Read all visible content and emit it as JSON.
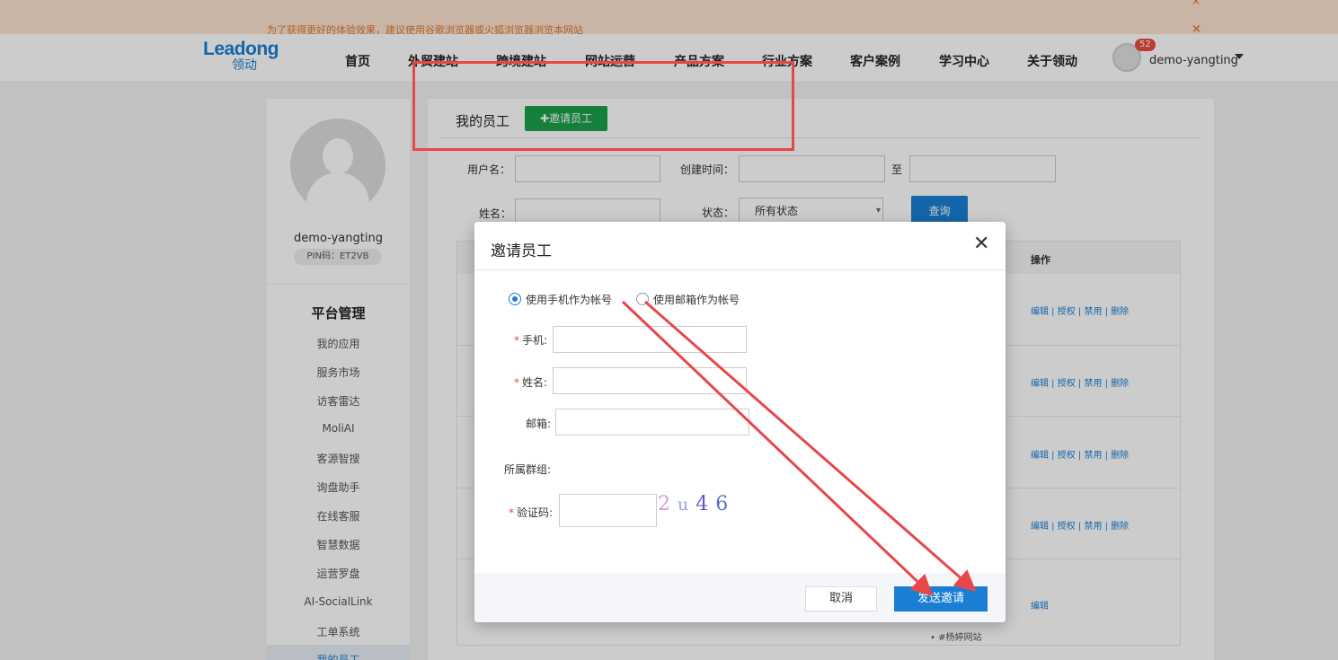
{
  "notices": {
    "line1": "",
    "line1_link": "",
    "line2": "为了获得更好的体验效果，建议使用谷歌浏览器或火狐浏览器浏览本网站",
    "close": "×"
  },
  "nav": {
    "logo_en": "Leadong",
    "logo_cn": "领动",
    "items": [
      "首页",
      "外贸建站",
      "跨境建站",
      "网站运营",
      "产品方案",
      "行业方案",
      "客户案例",
      "学习中心",
      "关于领动"
    ],
    "badge": "52",
    "username": "demo-yangting"
  },
  "sidebar": {
    "name": "demo-yangting",
    "pin": "PIN码：ET2VB",
    "title": "平台管理",
    "items": [
      "我的应用",
      "服务市场",
      "访客雷达",
      "MoliAI",
      "客源智搜",
      "询盘助手",
      "在线客服",
      "智慧数据",
      "运营罗盘",
      "AI-SocialLink",
      "工单系统",
      "我的员工"
    ]
  },
  "main": {
    "title": "我的员工",
    "invite_button": "✚邀请员工",
    "filters": {
      "username_label": "用户名：",
      "created_label": "创建时间：",
      "to_label": "至",
      "name_label": "姓名：",
      "status_label": "状态：",
      "status_value": "所有状态",
      "query_button": "查询"
    },
    "table": {
      "op_header": "操作",
      "row_ops": [
        "编辑 | 授权 | 禁用 | 删除",
        "编辑 | 授权 | 禁用 | 删除",
        "编辑 | 授权 | 禁用 | 删除",
        "编辑 | 授权 | 禁用 | 删除",
        "编辑"
      ],
      "footer_text": "• #杨婷网站"
    }
  },
  "dialog": {
    "title": "邀请员工",
    "close": "✕",
    "radio_phone": "使用手机作为帐号",
    "radio_email": "使用邮箱作为帐号",
    "phone_label": "手机:",
    "name_label": "姓名:",
    "email_label": "邮箱:",
    "group_label": "所属群组:",
    "captcha_label": "验证码:",
    "captcha_chars": [
      "2",
      "u",
      "4",
      "6"
    ],
    "cancel": "取消",
    "send": "发送邀请"
  },
  "colors": {
    "accent": "#1a7fd4",
    "green": "#1aa14a",
    "annotation": "#e8474a"
  }
}
